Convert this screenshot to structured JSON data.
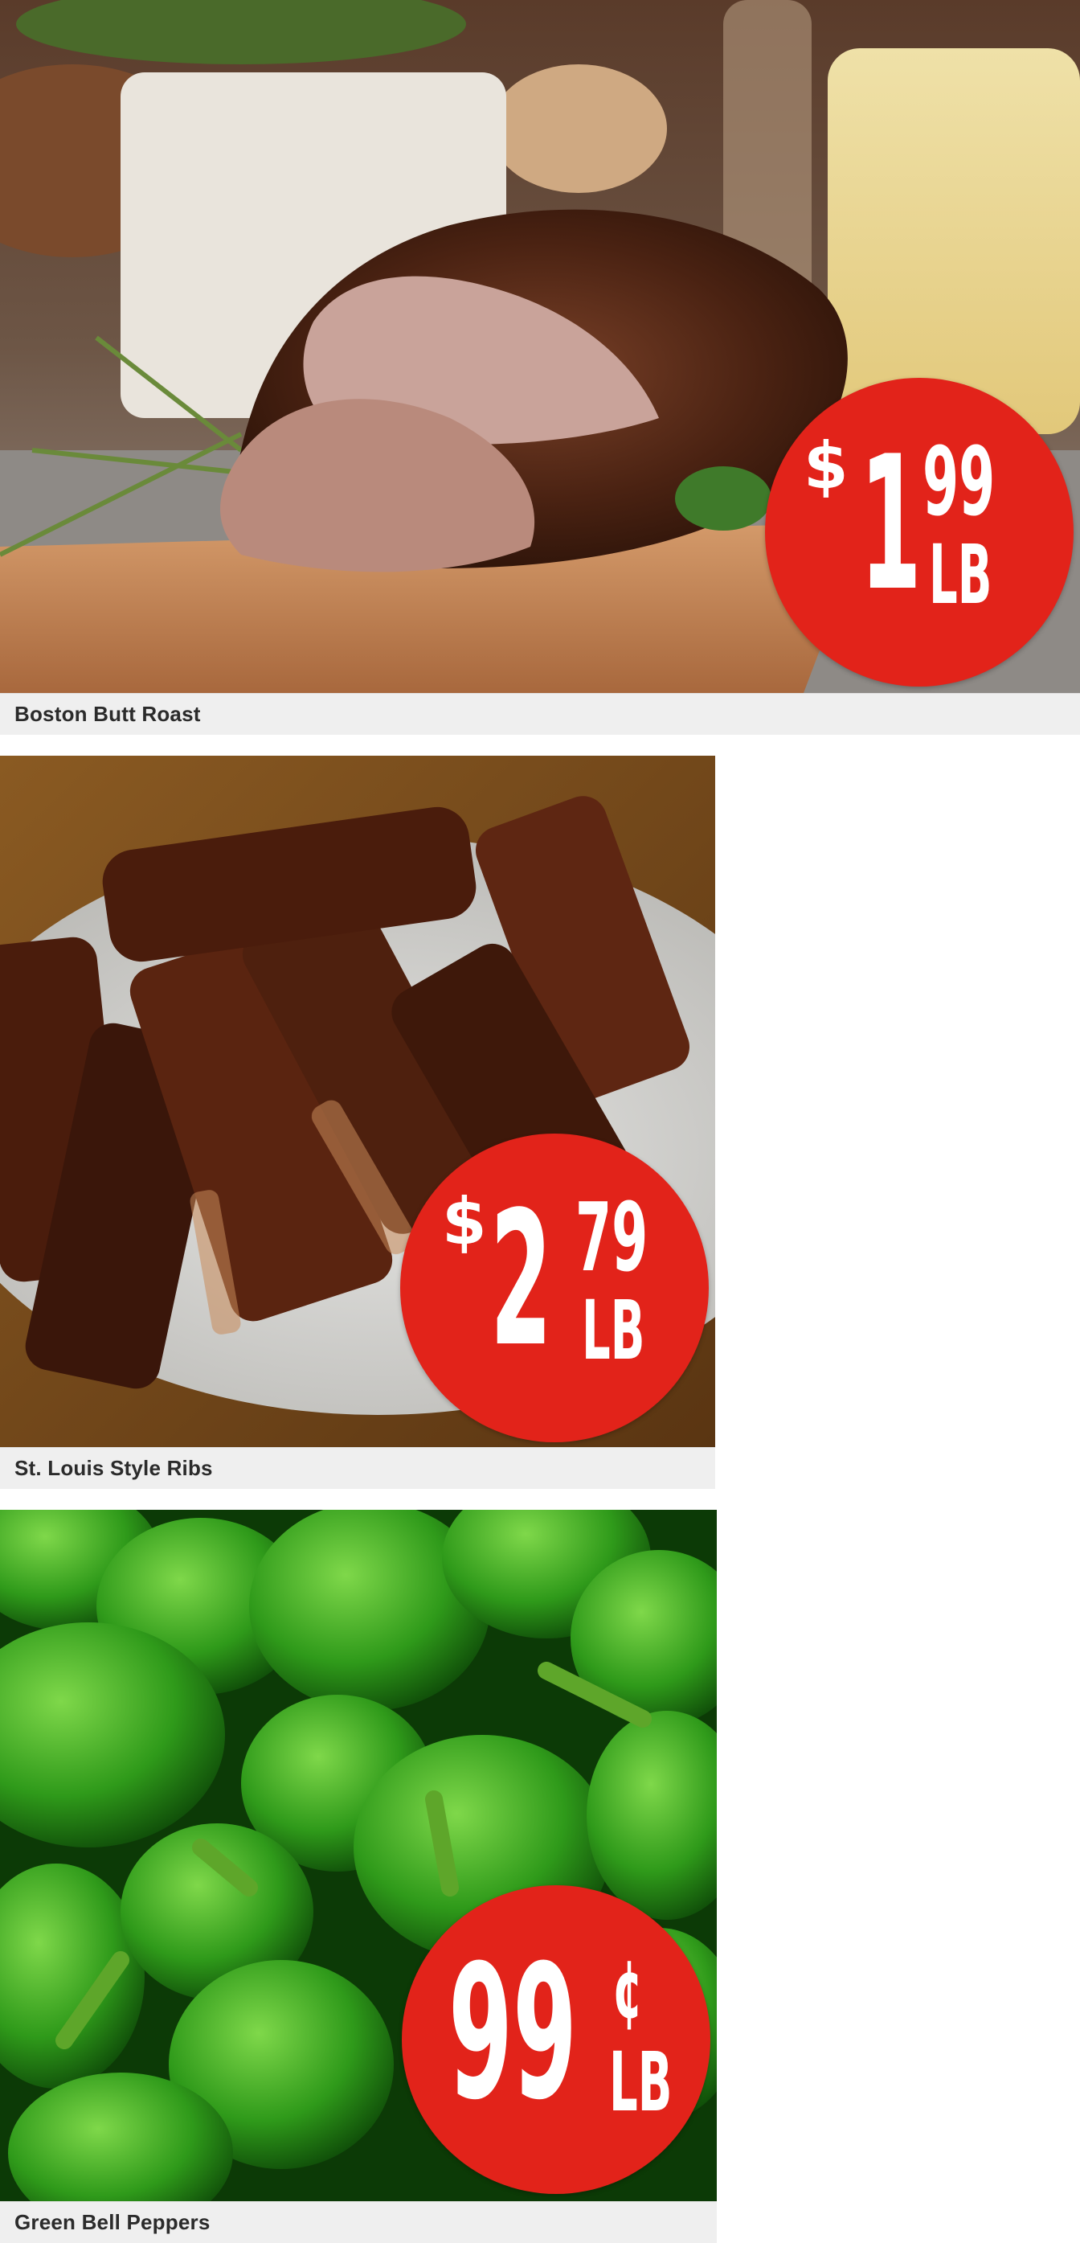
{
  "products": [
    {
      "name": "Boston Butt Roast",
      "image_icon": "roast-pork-photo",
      "price": {
        "currency": "$",
        "whole": "1",
        "cents": "99",
        "unit": "LB"
      }
    },
    {
      "name": "St. Louis Style Ribs",
      "image_icon": "bbq-ribs-photo",
      "price": {
        "currency": "$",
        "whole": "2",
        "cents": "79",
        "unit": "LB"
      }
    },
    {
      "name": "Green Bell Peppers",
      "image_icon": "green-peppers-photo",
      "price": {
        "amount": "99",
        "cent_sign": "¢",
        "unit": "LB"
      }
    }
  ],
  "colors": {
    "badge": "#e2231a",
    "caption_bg": "#efefef",
    "caption_text": "#2b2b2b"
  }
}
